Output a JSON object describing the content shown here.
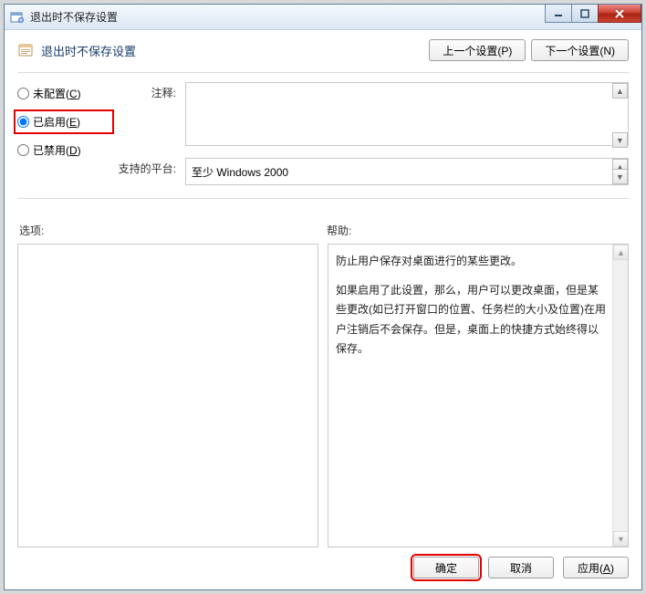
{
  "window": {
    "title": "退出时不保存设置"
  },
  "header": {
    "title": "退出时不保存设置",
    "prev_button": "上一个设置(P)",
    "next_button": "下一个设置(N)",
    "prev_key": "P",
    "next_key": "N"
  },
  "radio": {
    "not_configured": "未配置(",
    "not_configured_key": "C",
    "enabled": "已启用(",
    "enabled_key": "E",
    "disabled": "已禁用(",
    "disabled_key": "D",
    "close_paren": ")",
    "selected": "enabled"
  },
  "fields": {
    "comment_label": "注释:",
    "comment_value": "",
    "platform_label": "支持的平台:",
    "platform_value": "至少 Windows 2000"
  },
  "labels": {
    "options": "选项:",
    "help": "帮助:"
  },
  "help": {
    "line1": "防止用户保存对桌面进行的某些更改。",
    "para2": "如果启用了此设置，那么，用户可以更改桌面，但是某些更改(如已打开窗口的位置、任务栏的大小及位置)在用户注销后不会保存。但是，桌面上的快捷方式始终得以保存。"
  },
  "footer": {
    "ok": "确定",
    "cancel": "取消",
    "apply": "应用(",
    "apply_key": "A",
    "close_paren": ")"
  }
}
